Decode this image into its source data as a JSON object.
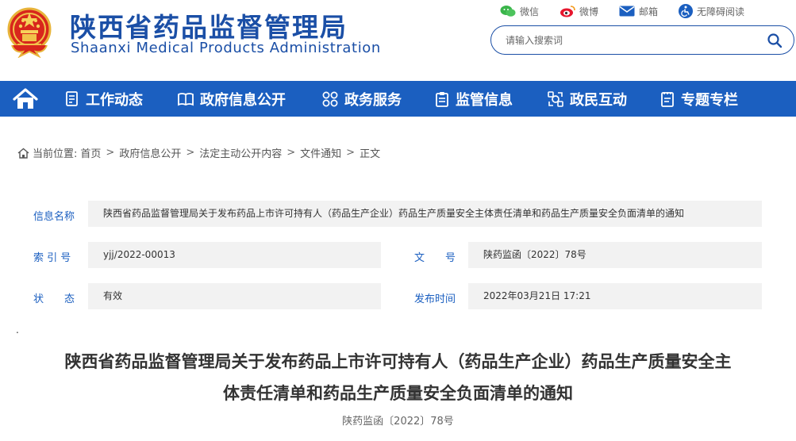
{
  "header": {
    "title": "陕西省药品监督管理局",
    "subtitle": "Shaanxi Medical Products Administration",
    "emblem_icon": "national-emblem-icon",
    "brand_color": "#1b4fa6",
    "top_links": [
      {
        "label": "微信",
        "icon": "wechat-icon",
        "color": "#3ab54a"
      },
      {
        "label": "微博",
        "icon": "weibo-icon",
        "color": "#e6162d"
      },
      {
        "label": "邮箱",
        "icon": "mail-icon",
        "color": "#1b5fc0"
      },
      {
        "label": "无障碍阅读",
        "icon": "accessibility-icon",
        "color": "#1b5fc0"
      }
    ],
    "search": {
      "placeholder": "请输入搜索词",
      "value": ""
    }
  },
  "nav": {
    "background": "#1b5fc0",
    "items": [
      {
        "label": "工作动态",
        "icon": "document-list-icon"
      },
      {
        "label": "政府信息公开",
        "icon": "book-icon"
      },
      {
        "label": "政务服务",
        "icon": "grid-icon"
      },
      {
        "label": "监管信息",
        "icon": "clipboard-icon"
      },
      {
        "label": "政民互动",
        "icon": "interaction-icon"
      },
      {
        "label": "专题专栏",
        "icon": "notes-icon"
      }
    ]
  },
  "breadcrumb": {
    "prefix": "当前位置:",
    "items": [
      "首页",
      "政府信息公开",
      "法定主动公开内容",
      "文件通知",
      "正文"
    ],
    "separator": ">"
  },
  "info": {
    "name_label": "信息名称",
    "name_value": "陕西省药品监督管理局关于发布药品上市许可持有人（药品生产企业）药品生产质量安全主体责任清单和药品生产质量安全负面清单的通知",
    "index_label": "索 引 号",
    "index_value": "yjj/2022-00013",
    "docno_label": "文　　号",
    "docno_value": "陕药监函〔2022〕78号",
    "status_label": "状　　态",
    "status_value": "有效",
    "date_label": "发布时间",
    "date_value": "2022年03月21日 17:21"
  },
  "article": {
    "dot": ".",
    "title_line1": "陕西省药品监督管理局关于发布药品上市许可持有人（药品生产企业）药品生产质量安全主",
    "title_line2": "体责任清单和药品生产质量安全负面清单的通知",
    "doc_number": "陕药监函〔2022〕78号"
  }
}
